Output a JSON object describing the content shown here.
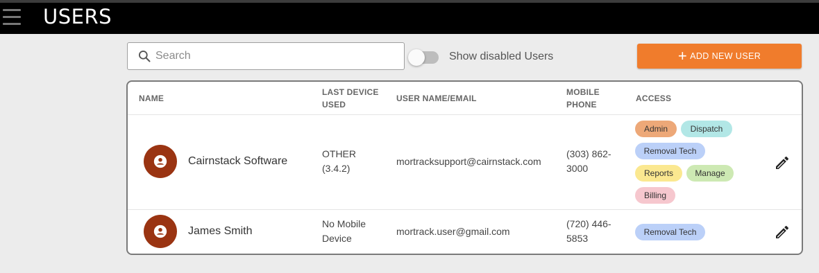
{
  "header": {
    "title": "USERS",
    "menu_icon": "hamburger-menu-icon"
  },
  "toolbar": {
    "search_placeholder": "Search",
    "search_value": "",
    "toggle_label": "Show disabled Users",
    "toggle_on": false,
    "add_button_label": "ADD NEW USER",
    "accent_color": "#f07c2c"
  },
  "table": {
    "columns": {
      "name": "NAME",
      "last_device_1": "LAST DEVICE",
      "last_device_2": "USED",
      "email": "USER NAME/EMAIL",
      "mobile_1": "MOBILE",
      "mobile_2": "PHONE",
      "access": "ACCESS"
    },
    "rows": [
      {
        "name": "Cairnstack Software",
        "device_1": "OTHER",
        "device_2": "(3.4.2)",
        "email": "mortracksupport@cairnstack.com",
        "phone_1": "(303) 862-",
        "phone_2": "3000",
        "access": [
          "Admin",
          "Dispatch",
          "Removal Tech",
          "Reports",
          "Manage",
          "Billing"
        ]
      },
      {
        "name": "James Smith",
        "device_1": "No Mobile",
        "device_2": "Device",
        "email": "mortrack.user@gmail.com",
        "phone_1": "(720) 446-",
        "phone_2": "5853",
        "access": [
          "Removal Tech"
        ]
      }
    ]
  },
  "chip_colors": {
    "Admin": "#eda878",
    "Dispatch": "#b2e7e6",
    "Removal Tech": "#bbd0f8",
    "Reports": "#fbe890",
    "Manage": "#cde9b3",
    "Billing": "#f6c7ce"
  }
}
